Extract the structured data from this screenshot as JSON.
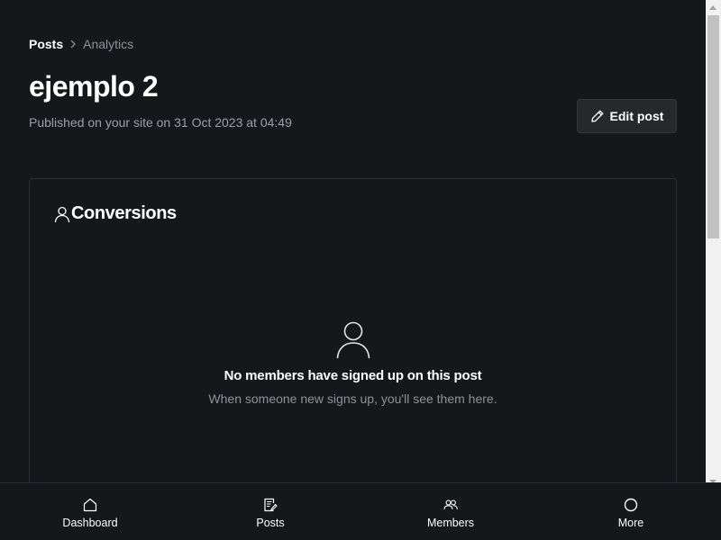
{
  "breadcrumb": {
    "parent": "Posts",
    "current": "Analytics"
  },
  "post": {
    "title": "ejemplo 2",
    "published_text": "Published on your site on 31 Oct 2023 at 04:49"
  },
  "actions": {
    "edit_label": "Edit post"
  },
  "conversions": {
    "title": "Conversions",
    "empty_title": "No members have signed up on this post",
    "empty_description": "When someone new signs up, you'll see them here."
  },
  "bottom_nav": {
    "items": [
      {
        "label": "Dashboard",
        "icon": "home-icon"
      },
      {
        "label": "Posts",
        "icon": "posts-icon"
      },
      {
        "label": "Members",
        "icon": "members-icon"
      },
      {
        "label": "More",
        "icon": "circle-icon"
      }
    ]
  },
  "colors": {
    "background": "#15171a",
    "muted_text": "#8e9196",
    "button_bg": "#26282c",
    "card_border": "#2a2d31"
  }
}
